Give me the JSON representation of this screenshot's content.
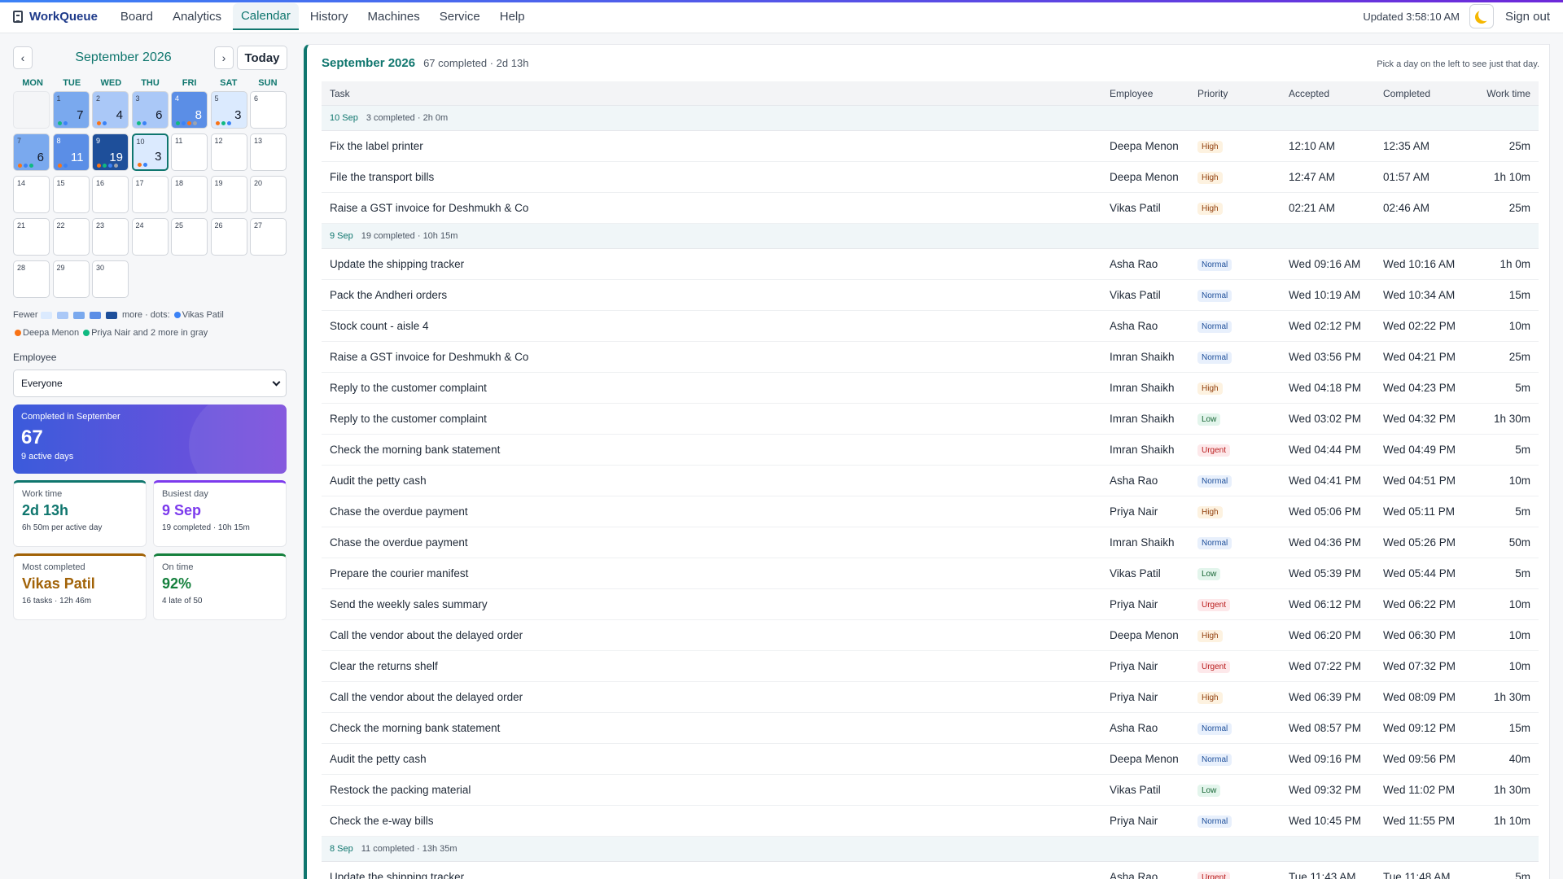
{
  "app": {
    "name": "WorkQueue"
  },
  "nav": [
    {
      "label": "Board",
      "active": false
    },
    {
      "label": "Analytics",
      "active": false
    },
    {
      "label": "Calendar",
      "active": true
    },
    {
      "label": "History",
      "active": false
    },
    {
      "label": "Machines",
      "active": false
    },
    {
      "label": "Service",
      "active": false
    },
    {
      "label": "Help",
      "active": false
    }
  ],
  "header": {
    "updated": "Updated 3:58:10 AM",
    "theme_icon": "moon-icon",
    "signout": "Sign out"
  },
  "calendar": {
    "prev": "‹",
    "next": "›",
    "month_title": "September 2026",
    "today": "Today",
    "weekdays": [
      "MON",
      "TUE",
      "WED",
      "THU",
      "FRI",
      "SAT",
      "SUN"
    ],
    "days": [
      {
        "empty": true
      },
      {
        "day": "1",
        "count": "7",
        "level": "l3",
        "dots": [
          "#10b981",
          "#3b82f6"
        ]
      },
      {
        "day": "2",
        "count": "4",
        "level": "l2",
        "dots": [
          "#f97316",
          "#3b82f6"
        ]
      },
      {
        "day": "3",
        "count": "6",
        "level": "l2",
        "dots": [
          "#10b981",
          "#3b82f6"
        ]
      },
      {
        "day": "4",
        "count": "8",
        "level": "l4",
        "dots": [
          "#10b981",
          "#3b82f6",
          "#f97316",
          "#9ca3af"
        ]
      },
      {
        "day": "5",
        "count": "3",
        "level": "l1",
        "dots": [
          "#f97316",
          "#10b981",
          "#3b82f6"
        ]
      },
      {
        "day": "6"
      },
      {
        "day": "7",
        "count": "6",
        "level": "l3",
        "dots": [
          "#f97316",
          "#3b82f6",
          "#10b981"
        ]
      },
      {
        "day": "8",
        "count": "11",
        "level": "l4",
        "dots": [
          "#f97316",
          "#3b82f6"
        ]
      },
      {
        "day": "9",
        "count": "19",
        "level": "l5",
        "dots": [
          "#f97316",
          "#10b981",
          "#3b82f6",
          "#9ca3af"
        ]
      },
      {
        "day": "10",
        "count": "3",
        "level": "l1",
        "selected": true,
        "dots": [
          "#f97316",
          "#3b82f6"
        ]
      },
      {
        "day": "11"
      },
      {
        "day": "12"
      },
      {
        "day": "13"
      },
      {
        "day": "14"
      },
      {
        "day": "15"
      },
      {
        "day": "16"
      },
      {
        "day": "17"
      },
      {
        "day": "18"
      },
      {
        "day": "19"
      },
      {
        "day": "20"
      },
      {
        "day": "21"
      },
      {
        "day": "22"
      },
      {
        "day": "23"
      },
      {
        "day": "24"
      },
      {
        "day": "25"
      },
      {
        "day": "26"
      },
      {
        "day": "27"
      },
      {
        "day": "28"
      },
      {
        "day": "29"
      },
      {
        "day": "30"
      }
    ],
    "legend": {
      "fewer": "Fewer",
      "more": "more",
      "dots_label": "· dots:",
      "people": [
        {
          "name": "Vikas Patil",
          "color": "#3b82f6"
        },
        {
          "name": "Deepa Menon",
          "color": "#f97316"
        },
        {
          "name": "Priya Nair",
          "color": "#10b981"
        }
      ],
      "others": "and 2 more in gray"
    }
  },
  "employee": {
    "label": "Employee",
    "value": "Everyone"
  },
  "hero": {
    "label": "Completed in September",
    "value": "67",
    "sub": "9 active days"
  },
  "stats": [
    {
      "label": "Work time",
      "value": "2d 13h",
      "sub": "6h 50m per active day",
      "color": "#0f766e"
    },
    {
      "label": "Busiest day",
      "value": "9 Sep",
      "sub": "19 completed · 10h 15m",
      "color": "#7c3aed"
    },
    {
      "label": "Most completed",
      "value": "Vikas Patil",
      "sub": "16 tasks · 12h 46m",
      "color": "#a16207"
    },
    {
      "label": "On time",
      "value": "92%",
      "sub": "4 late of 50",
      "color": "#15803d"
    }
  ],
  "main": {
    "title": "September 2026",
    "summary": "67 completed · 2d 13h",
    "hint": "Pick a day on the left to see just that day.",
    "columns": [
      "Task",
      "Employee",
      "Priority",
      "Accepted",
      "Completed",
      "Work time"
    ],
    "groups": [
      {
        "date": "10 Sep",
        "summary": "3 completed · 2h 0m",
        "rows": [
          [
            "Fix the label printer",
            "Deepa Menon",
            "High",
            "12:10 AM",
            "12:35 AM",
            "25m"
          ],
          [
            "File the transport bills",
            "Deepa Menon",
            "High",
            "12:47 AM",
            "01:57 AM",
            "1h 10m"
          ],
          [
            "Raise a GST invoice for Deshmukh & Co",
            "Vikas Patil",
            "High",
            "02:21 AM",
            "02:46 AM",
            "25m"
          ]
        ]
      },
      {
        "date": "9 Sep",
        "summary": "19 completed · 10h 15m",
        "rows": [
          [
            "Update the shipping tracker",
            "Asha Rao",
            "Normal",
            "Wed 09:16 AM",
            "Wed 10:16 AM",
            "1h 0m"
          ],
          [
            "Pack the Andheri orders",
            "Vikas Patil",
            "Normal",
            "Wed 10:19 AM",
            "Wed 10:34 AM",
            "15m"
          ],
          [
            "Stock count - aisle 4",
            "Asha Rao",
            "Normal",
            "Wed 02:12 PM",
            "Wed 02:22 PM",
            "10m"
          ],
          [
            "Raise a GST invoice for Deshmukh & Co",
            "Imran Shaikh",
            "Normal",
            "Wed 03:56 PM",
            "Wed 04:21 PM",
            "25m"
          ],
          [
            "Reply to the customer complaint",
            "Imran Shaikh",
            "High",
            "Wed 04:18 PM",
            "Wed 04:23 PM",
            "5m"
          ],
          [
            "Reply to the customer complaint",
            "Imran Shaikh",
            "Low",
            "Wed 03:02 PM",
            "Wed 04:32 PM",
            "1h 30m"
          ],
          [
            "Check the morning bank statement",
            "Imran Shaikh",
            "Urgent",
            "Wed 04:44 PM",
            "Wed 04:49 PM",
            "5m"
          ],
          [
            "Audit the petty cash",
            "Asha Rao",
            "Normal",
            "Wed 04:41 PM",
            "Wed 04:51 PM",
            "10m"
          ],
          [
            "Chase the overdue payment",
            "Priya Nair",
            "High",
            "Wed 05:06 PM",
            "Wed 05:11 PM",
            "5m"
          ],
          [
            "Chase the overdue payment",
            "Imran Shaikh",
            "Normal",
            "Wed 04:36 PM",
            "Wed 05:26 PM",
            "50m"
          ],
          [
            "Prepare the courier manifest",
            "Vikas Patil",
            "Low",
            "Wed 05:39 PM",
            "Wed 05:44 PM",
            "5m"
          ],
          [
            "Send the weekly sales summary",
            "Priya Nair",
            "Urgent",
            "Wed 06:12 PM",
            "Wed 06:22 PM",
            "10m"
          ],
          [
            "Call the vendor about the delayed order",
            "Deepa Menon",
            "High",
            "Wed 06:20 PM",
            "Wed 06:30 PM",
            "10m"
          ],
          [
            "Clear the returns shelf",
            "Priya Nair",
            "Urgent",
            "Wed 07:22 PM",
            "Wed 07:32 PM",
            "10m"
          ],
          [
            "Call the vendor about the delayed order",
            "Priya Nair",
            "High",
            "Wed 06:39 PM",
            "Wed 08:09 PM",
            "1h 30m"
          ],
          [
            "Check the morning bank statement",
            "Asha Rao",
            "Normal",
            "Wed 08:57 PM",
            "Wed 09:12 PM",
            "15m"
          ],
          [
            "Audit the petty cash",
            "Deepa Menon",
            "Normal",
            "Wed 09:16 PM",
            "Wed 09:56 PM",
            "40m"
          ],
          [
            "Restock the packing material",
            "Vikas Patil",
            "Low",
            "Wed 09:32 PM",
            "Wed 11:02 PM",
            "1h 30m"
          ],
          [
            "Check the e-way bills",
            "Priya Nair",
            "Normal",
            "Wed 10:45 PM",
            "Wed 11:55 PM",
            "1h 10m"
          ]
        ]
      },
      {
        "date": "8 Sep",
        "summary": "11 completed · 13h 35m",
        "rows": [
          [
            "Update the shipping tracker",
            "Asha Rao",
            "Urgent",
            "Tue 11:43 AM",
            "Tue 11:48 AM",
            "5m"
          ]
        ]
      }
    ]
  }
}
